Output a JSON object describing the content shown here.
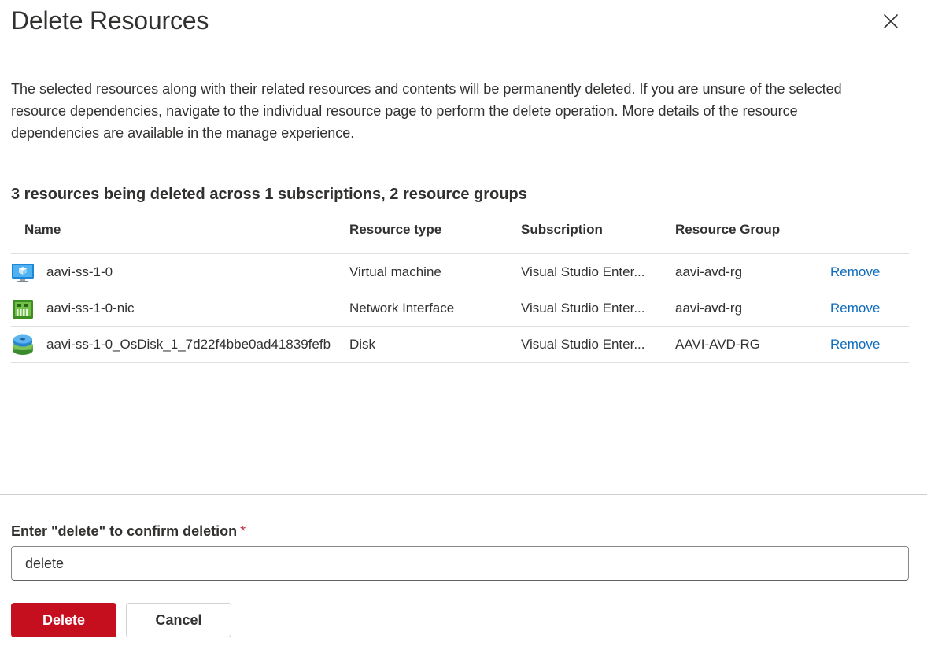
{
  "dialog": {
    "title": "Delete Resources",
    "description": "The selected resources along with their related resources and contents will be permanently deleted. If you are unsure of the selected resource dependencies, navigate to the individual resource page to perform the delete operation. More details of the resource dependencies are available in the manage experience.",
    "summary": "3 resources being deleted across 1 subscriptions, 2 resource groups"
  },
  "table": {
    "headers": {
      "name": "Name",
      "type": "Resource type",
      "subscription": "Subscription",
      "resource_group": "Resource Group"
    },
    "rows": [
      {
        "icon": "virtual-machine-icon",
        "name": "aavi-ss-1-0",
        "type": "Virtual machine",
        "subscription": "Visual Studio Enter...",
        "resource_group": "aavi-avd-rg",
        "action": "Remove"
      },
      {
        "icon": "network-interface-icon",
        "name": "aavi-ss-1-0-nic",
        "type": "Network Interface",
        "subscription": "Visual Studio Enter...",
        "resource_group": "aavi-avd-rg",
        "action": "Remove"
      },
      {
        "icon": "disk-icon",
        "name": "aavi-ss-1-0_OsDisk_1_7d22f4bbe0ad41839fefb",
        "type": "Disk",
        "subscription": "Visual Studio Enter...",
        "resource_group": "AAVI-AVD-RG",
        "action": "Remove"
      }
    ]
  },
  "confirm": {
    "label": "Enter \"delete\" to confirm deletion",
    "required_mark": "*",
    "value": "delete"
  },
  "buttons": {
    "delete": "Delete",
    "cancel": "Cancel"
  },
  "colors": {
    "accent_link": "#0f6cbd",
    "danger": "#c50f1f",
    "required": "#c4314b"
  }
}
